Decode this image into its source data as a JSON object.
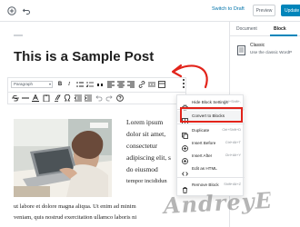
{
  "topbar": {
    "switch_to_draft": "Switch to Draft",
    "preview": "Preview",
    "update": "Update"
  },
  "sidebar": {
    "tabs": [
      {
        "label": "Document",
        "active": false
      },
      {
        "label": "Block",
        "active": true
      }
    ],
    "block_card": {
      "icon": "document-icon",
      "title": "Classic",
      "description": "Use the classic WordP"
    }
  },
  "editor": {
    "title": "This is a Sample Post",
    "format_select": "Paragraph",
    "toolbar_buttons": [
      "B",
      "I",
      "link",
      "bullet-list",
      "numbered-list",
      "align-left",
      "align-center",
      "align-right",
      "strikethrough",
      "more"
    ],
    "paragraph_lines": [
      "Lorem ipsum",
      "dolor sit amet,",
      "consectetur",
      "adipiscing elit, s",
      "do eiusmod",
      "tempor incididun"
    ],
    "bottom_lines": [
      "ut labore et dolore magna aliqua. Ut enim ad minim",
      "veniam, quis nostrud exercitation ullamco laboris ni"
    ]
  },
  "block_menu": {
    "items": [
      {
        "label": "Hide Block Settings",
        "shortcut": "Ctrl+Shift+,",
        "icon": "gear-icon"
      },
      {
        "label": "Convert to Blocks",
        "shortcut": "",
        "icon": "convert-icon"
      },
      {
        "label": "Duplicate",
        "shortcut": "Ctrl+Shift+D",
        "icon": "duplicate-icon"
      },
      {
        "label": "Insert Before",
        "shortcut": "Ctrl+Alt+T",
        "icon": "insert-before-icon"
      },
      {
        "label": "Insert After",
        "shortcut": "Ctrl+Alt+Y",
        "icon": "insert-after-icon"
      },
      {
        "label": "Edit as HTML",
        "shortcut": "",
        "icon": "html-icon"
      },
      {
        "label": "Remove Block",
        "shortcut": "Shift+Alt+Z",
        "icon": "trash-icon"
      }
    ]
  },
  "watermark": "AndreyEX",
  "colors": {
    "accent": "#0085ba",
    "annotation": "#e2231a",
    "link": "#0073aa"
  }
}
